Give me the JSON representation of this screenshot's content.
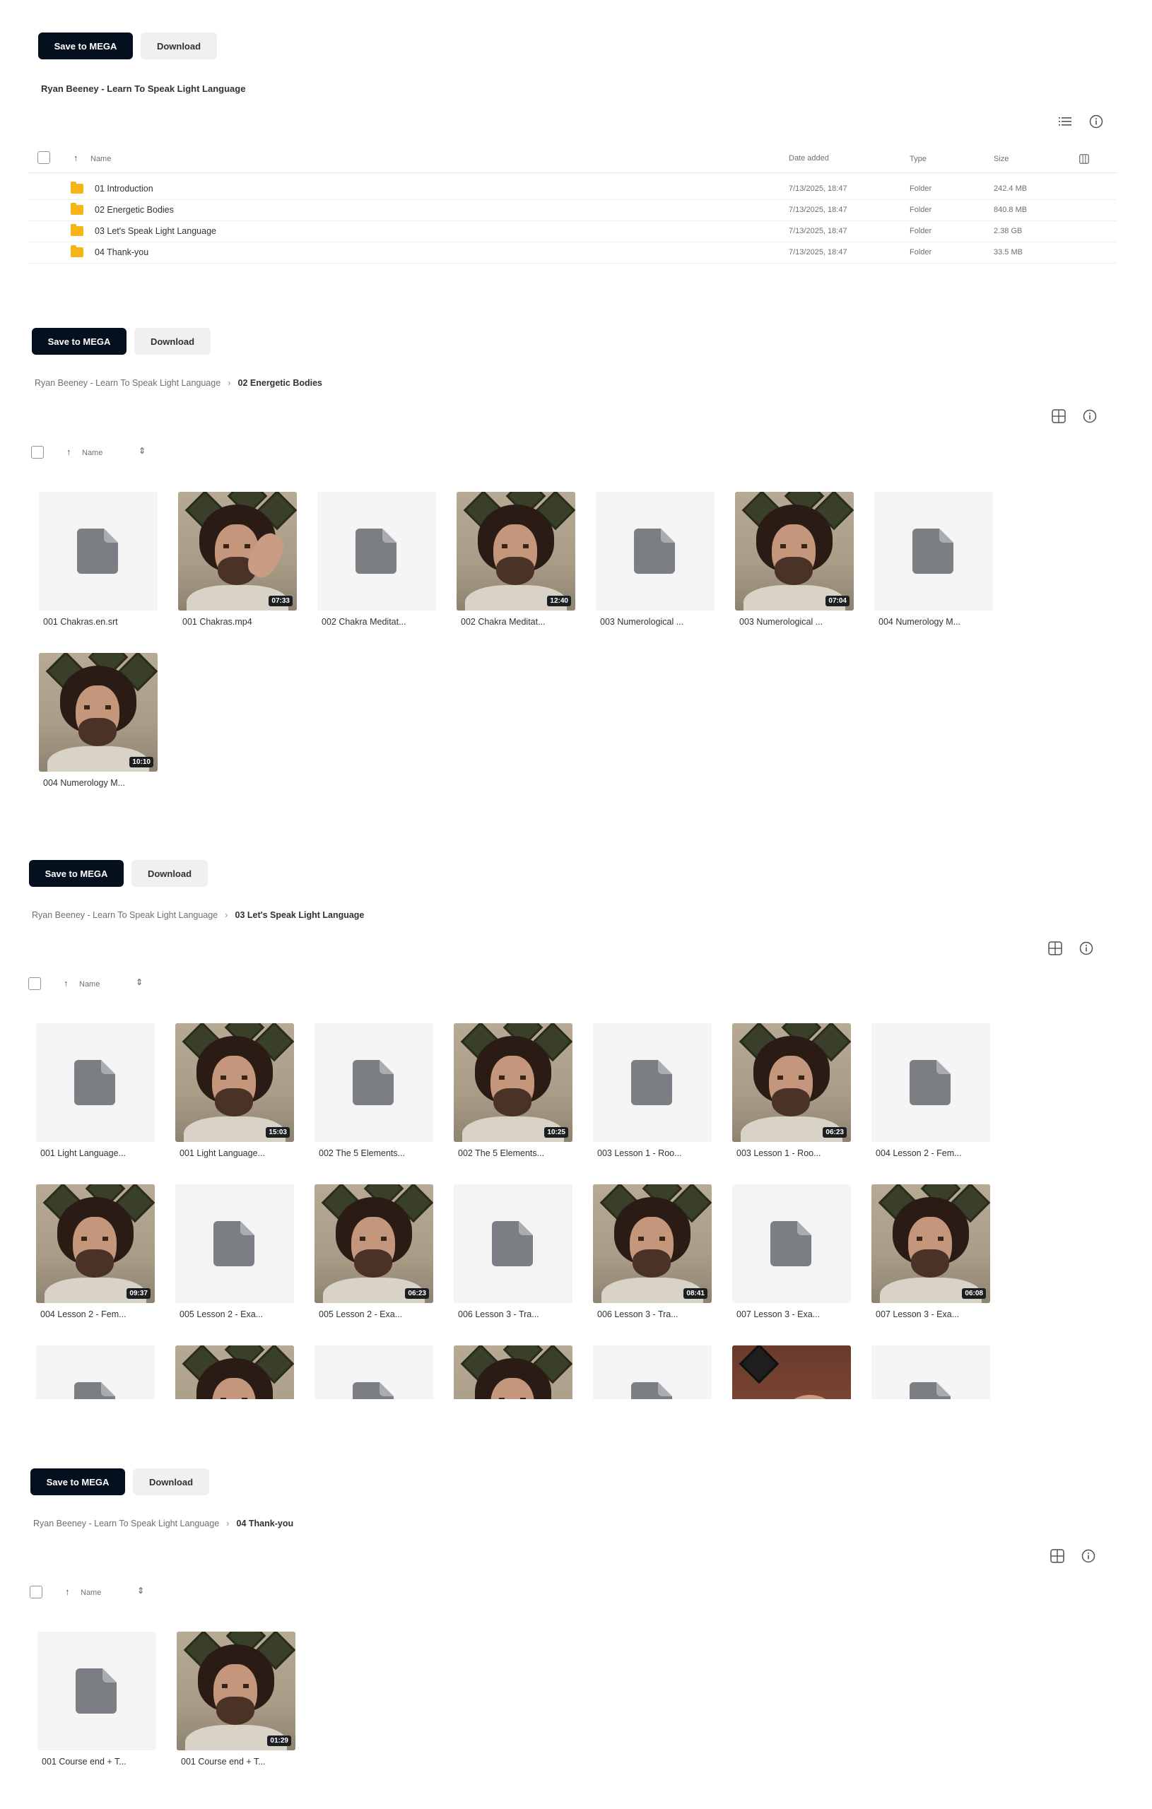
{
  "panel1": {
    "save_label": "Save to MEGA",
    "download_label": "Download",
    "title": "Ryan Beeney - Learn To Speak Light Language",
    "columns": {
      "name": "Name",
      "date": "Date added",
      "type": "Type",
      "size": "Size"
    },
    "rows": [
      {
        "name": "01 Introduction",
        "date": "7/13/2025, 18:47",
        "type": "Folder",
        "size": "242.4 MB"
      },
      {
        "name": "02 Energetic Bodies",
        "date": "7/13/2025, 18:47",
        "type": "Folder",
        "size": "840.8 MB"
      },
      {
        "name": "03 Let's Speak Light Language",
        "date": "7/13/2025, 18:47",
        "type": "Folder",
        "size": "2.38 GB"
      },
      {
        "name": "04 Thank-you",
        "date": "7/13/2025, 18:47",
        "type": "Folder",
        "size": "33.5 MB"
      }
    ]
  },
  "panel2": {
    "save_label": "Save to MEGA",
    "download_label": "Download",
    "breadcrumb_root": "Ryan Beeney - Learn To Speak Light Language",
    "breadcrumb_current": "02 Energetic Bodies",
    "sort_label": "Name",
    "items": [
      {
        "label": "001 Chakras.en.srt",
        "kind": "doc"
      },
      {
        "label": "001 Chakras.mp4",
        "kind": "video",
        "duration": "07:33",
        "variant": "hand"
      },
      {
        "label": "002 Chakra Meditat...",
        "kind": "doc"
      },
      {
        "label": "002 Chakra Meditat...",
        "kind": "video",
        "duration": "12:40"
      },
      {
        "label": "003 Numerological ...",
        "kind": "doc"
      },
      {
        "label": "003 Numerological ...",
        "kind": "video",
        "duration": "07:04"
      },
      {
        "label": "004 Numerology M...",
        "kind": "doc"
      },
      {
        "label": "004 Numerology M...",
        "kind": "video",
        "duration": "10:10"
      }
    ]
  },
  "panel3": {
    "save_label": "Save to MEGA",
    "download_label": "Download",
    "breadcrumb_root": "Ryan Beeney - Learn To Speak Light Language",
    "breadcrumb_current": "03 Let's Speak Light Language",
    "sort_label": "Name",
    "items": [
      {
        "label": "001 Light Language...",
        "kind": "doc"
      },
      {
        "label": "001 Light Language...",
        "kind": "video",
        "duration": "15:03"
      },
      {
        "label": "002 The 5 Elements...",
        "kind": "doc"
      },
      {
        "label": "002 The 5 Elements...",
        "kind": "video",
        "duration": "10:25"
      },
      {
        "label": "003 Lesson 1 - Roo...",
        "kind": "doc"
      },
      {
        "label": "003 Lesson 1 - Roo...",
        "kind": "video",
        "duration": "06:23"
      },
      {
        "label": "004 Lesson 2 - Fem...",
        "kind": "doc"
      },
      {
        "label": "004 Lesson 2 - Fem...",
        "kind": "video",
        "duration": "09:37"
      },
      {
        "label": "005 Lesson 2 - Exa...",
        "kind": "doc"
      },
      {
        "label": "005 Lesson 2 - Exa...",
        "kind": "video",
        "duration": "06:23"
      },
      {
        "label": "006 Lesson 3 - Tra...",
        "kind": "doc"
      },
      {
        "label": "006 Lesson 3 - Tra...",
        "kind": "video",
        "duration": "08:41"
      },
      {
        "label": "007 Lesson 3 - Exa...",
        "kind": "doc"
      },
      {
        "label": "007 Lesson 3 - Exa...",
        "kind": "video",
        "duration": "06:08"
      },
      {
        "label": "",
        "kind": "doc"
      },
      {
        "label": "",
        "kind": "video",
        "duration": ""
      },
      {
        "label": "",
        "kind": "doc"
      },
      {
        "label": "",
        "kind": "video",
        "duration": ""
      },
      {
        "label": "",
        "kind": "doc"
      },
      {
        "label": "",
        "kind": "video",
        "duration": "",
        "variant": "phone"
      },
      {
        "label": "",
        "kind": "doc"
      }
    ]
  },
  "panel4": {
    "save_label": "Save to MEGA",
    "download_label": "Download",
    "breadcrumb_root": "Ryan Beeney - Learn To Speak Light Language",
    "breadcrumb_current": "04 Thank-you",
    "sort_label": "Name",
    "items": [
      {
        "label": "001 Course end + T...",
        "kind": "doc"
      },
      {
        "label": "001 Course end + T...",
        "kind": "video",
        "duration": "01:29"
      }
    ]
  },
  "icons": {
    "list_view": "list-view-icon",
    "grid_view": "grid-view-icon",
    "info": "info-icon",
    "columns": "columns-icon",
    "file": "file-icon",
    "folder": "folder-icon"
  },
  "colors": {
    "primary_button": "#04101e",
    "folder": "#f6b516",
    "file_icon": "#7b7f84"
  }
}
